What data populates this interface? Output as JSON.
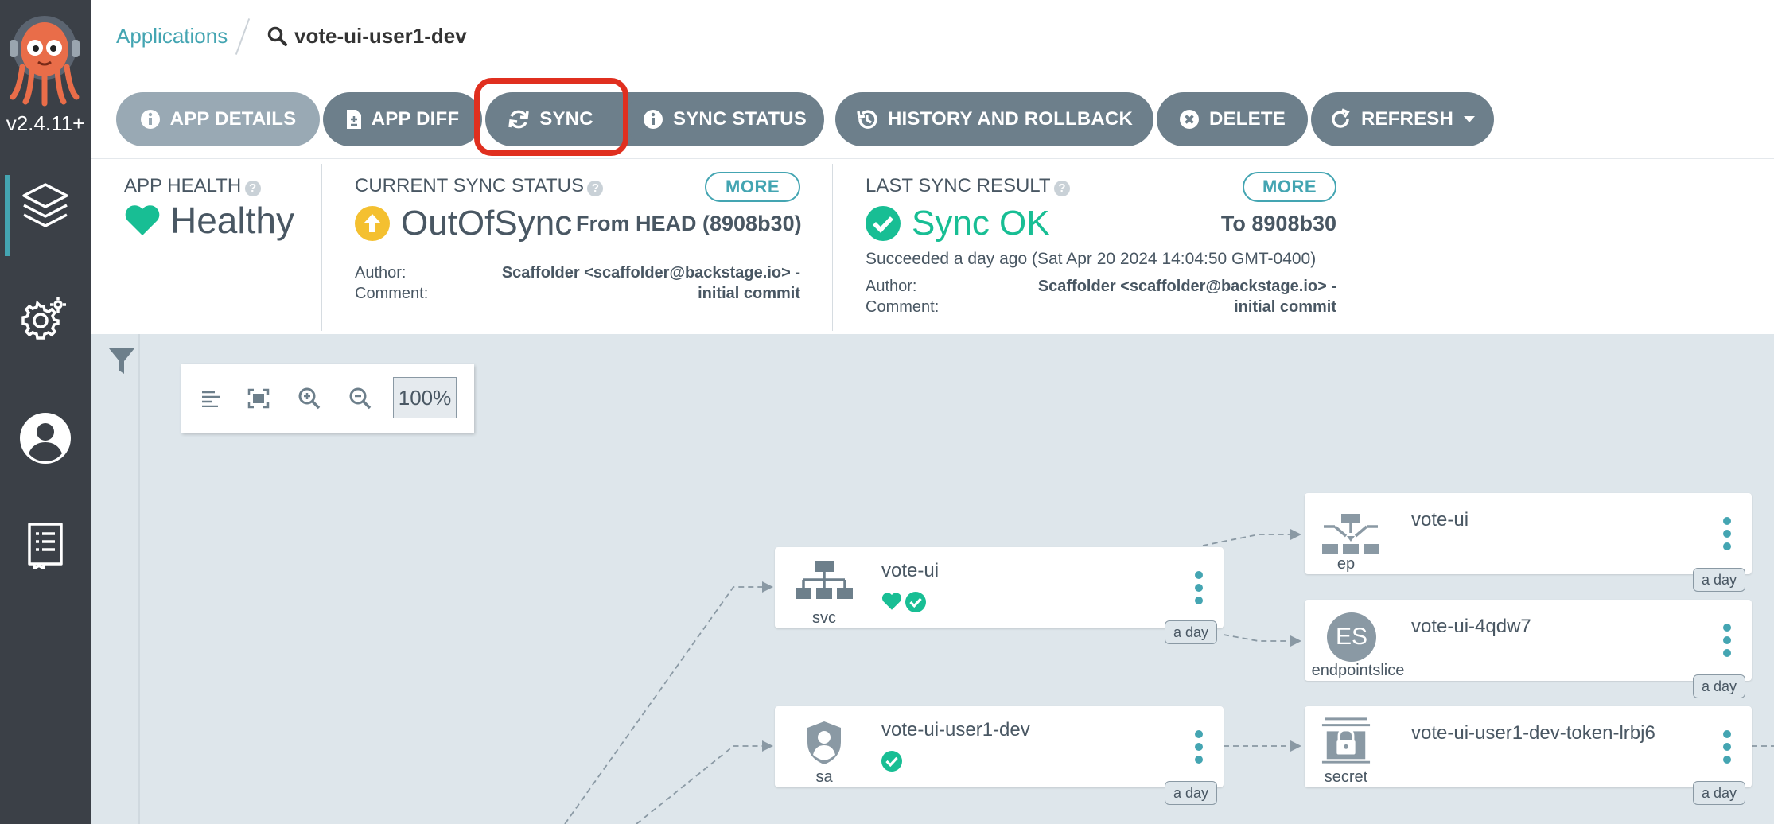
{
  "app": {
    "version": "v2.4.11+"
  },
  "breadcrumb": {
    "applications": "Applications",
    "current": "vote-ui-user1-dev"
  },
  "toolbar": {
    "app_details": "APP DETAILS",
    "app_diff": "APP DIFF",
    "sync": "SYNC",
    "sync_status": "SYNC STATUS",
    "history": "HISTORY AND ROLLBACK",
    "delete": "DELETE",
    "refresh": "REFRESH"
  },
  "health": {
    "label": "APP HEALTH",
    "value": "Healthy",
    "color": "#18be94"
  },
  "current_sync": {
    "label": "CURRENT SYNC STATUS",
    "more": "MORE",
    "value": "OutOfSync",
    "from": "From HEAD (8908b30)",
    "author_label": "Author:",
    "comment_label": "Comment:",
    "author_value": "Scaffolder <scaffolder@backstage.io> -",
    "comment_value": "initial commit",
    "color": "#f4c030"
  },
  "last_sync": {
    "label": "LAST SYNC RESULT",
    "more": "MORE",
    "value": "Sync OK",
    "to": "To 8908b30",
    "succeeded": "Succeeded a day ago (Sat Apr 20 2024 14:04:50 GMT-0400)",
    "author_label": "Author:",
    "comment_label": "Comment:",
    "author_value": "Scaffolder <scaffolder@backstage.io> -",
    "comment_value": "initial commit",
    "color": "#18be94"
  },
  "graph": {
    "zoom": "100%",
    "nodes": [
      {
        "name": "vote-ui",
        "kind": "svc",
        "age": "a day"
      },
      {
        "name": "vote-ui-user1-dev",
        "kind": "sa",
        "age": "a day"
      },
      {
        "name": "vote-ui",
        "kind": "ep",
        "age": "a day"
      },
      {
        "name": "vote-ui-4qdw7",
        "kind": "endpointslice",
        "badge": "ES",
        "age": "a day"
      },
      {
        "name": "vote-ui-user1-dev-token-lrbj6",
        "kind": "secret",
        "age": "a day"
      }
    ]
  },
  "colors": {
    "accent": "#44a5b2",
    "highlight": "#e02f1f",
    "button": "#6d7f8b"
  }
}
